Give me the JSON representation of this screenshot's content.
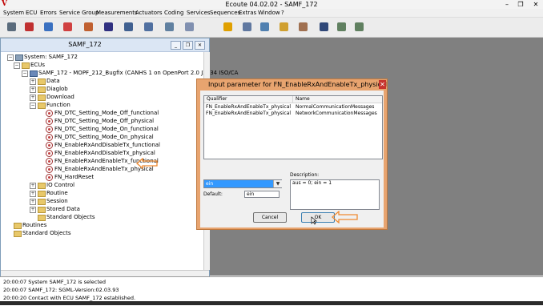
{
  "window": {
    "title": "Ecoute 04.02.02 - SAMF_172",
    "logo": "V",
    "controls": [
      "–",
      "❐",
      "✕"
    ]
  },
  "menu": [
    "System",
    "ECU",
    "Errors",
    "Service Group",
    "Measurements",
    "Actuators",
    "Coding",
    "Services",
    "Sequences",
    "Extras",
    "Window",
    "?"
  ],
  "toolbar": {
    "icons": [
      "connect-icon",
      "disconnect-icon",
      "check-icon",
      "stop-icon",
      "sign-icon",
      "car-icon",
      "car-data-icon",
      "picture-icon",
      "monitor-icon",
      "clipboard-icon",
      "flash-icon",
      "table-icon",
      "table-check-icon",
      "book-icon",
      "settings-tree-icon",
      "search-icon",
      "export-icon",
      "import-icon"
    ],
    "colors": [
      "#5a6b7c",
      "#c03030",
      "#3a70c0",
      "#d04040",
      "#c06030",
      "#303080",
      "#406090",
      "#5070a0",
      "#6080a0",
      "#8090b0",
      "#e0a000",
      "#6078a0",
      "#5080b0",
      "#d0a030",
      "#a07050",
      "#304878",
      "#608060",
      "#608060"
    ]
  },
  "tree_window": {
    "title": "SAMF_172",
    "controls": [
      "_",
      "❐",
      "✕"
    ],
    "rows": [
      {
        "label": "System: SAMF_172",
        "expander": "−",
        "icon": "system"
      },
      {
        "label": "ECUs",
        "expander": "−",
        "icon": "folder"
      },
      {
        "label": "SAMF_172 - MOPF_212_Bugfix (CANHS 1 on OpenPort 2.0 J2534 ISO/CA",
        "expander": "−",
        "icon": "ecu"
      },
      {
        "label": "Data",
        "expander": "+",
        "icon": "folder"
      },
      {
        "label": "Diaglob",
        "expander": "+",
        "icon": "folder"
      },
      {
        "label": "Download",
        "expander": "+",
        "icon": "folder"
      },
      {
        "label": "Function",
        "expander": "−",
        "icon": "folder"
      },
      {
        "label": "FN_DTC_Setting_Mode_Off_functional",
        "expander": "",
        "icon": "function"
      },
      {
        "label": "FN_DTC_Setting_Mode_Off_physical",
        "expander": "",
        "icon": "function"
      },
      {
        "label": "FN_DTC_Setting_Mode_On_functional",
        "expander": "",
        "icon": "function"
      },
      {
        "label": "FN_DTC_Setting_Mode_On_physical",
        "expander": "",
        "icon": "function"
      },
      {
        "label": "FN_EnableRxAndDisableTx_functional",
        "expander": "",
        "icon": "function"
      },
      {
        "label": "FN_EnableRxAndDisableTx_physical",
        "expander": "",
        "icon": "function"
      },
      {
        "label": "FN_EnableRxAndEnableTx_functional",
        "expander": "",
        "icon": "function"
      },
      {
        "label": "FN_EnableRxAndEnableTx_physical",
        "expander": "",
        "icon": "function"
      },
      {
        "label": "FN_HardReset",
        "expander": "",
        "icon": "function"
      },
      {
        "label": "IO Control",
        "expander": "+",
        "icon": "folder"
      },
      {
        "label": "Routine",
        "expander": "+",
        "icon": "folder"
      },
      {
        "label": "Session",
        "expander": "+",
        "icon": "folder"
      },
      {
        "label": "Stored Data",
        "expander": "+",
        "icon": "folder"
      },
      {
        "label": "Standard Objects",
        "expander": "",
        "icon": "folder"
      },
      {
        "label": "Routines",
        "expander": "",
        "icon": "folder"
      },
      {
        "label": "Standard Objects",
        "expander": "",
        "icon": "folder"
      }
    ]
  },
  "dialog": {
    "title": "Input parameter for FN_EnableRxAndEnableTx_physical",
    "close": "✕",
    "columns": [
      "Qualifier",
      "Name"
    ],
    "rows": [
      [
        "FN_EnableRxAndEnableTx_physical",
        "NormalCommunicationMessages"
      ],
      [
        "FN_EnableRxAndEnableTx_physical",
        "NetworkCommunicationMessages"
      ]
    ],
    "value_selected": "ein",
    "default_label": "Default:",
    "default_value": "ein",
    "description_label": "Description:",
    "description_value": "aus = 0; ein = 1",
    "cancel_label": "Cancel",
    "ok_label": "OK",
    "combo_arrow": "▼"
  },
  "status": [
    "20:00:07 System SAMF_172 is selected",
    "20:00:07 SAMF_172: SGML-Version:02.03.93",
    "20:00:20 Contact with ECU SAMF_172 established."
  ],
  "accent_colors": {
    "dialog_frame": "#e8a46f",
    "annotation_arrow": "#f08a30",
    "selection": "#3399ff"
  }
}
